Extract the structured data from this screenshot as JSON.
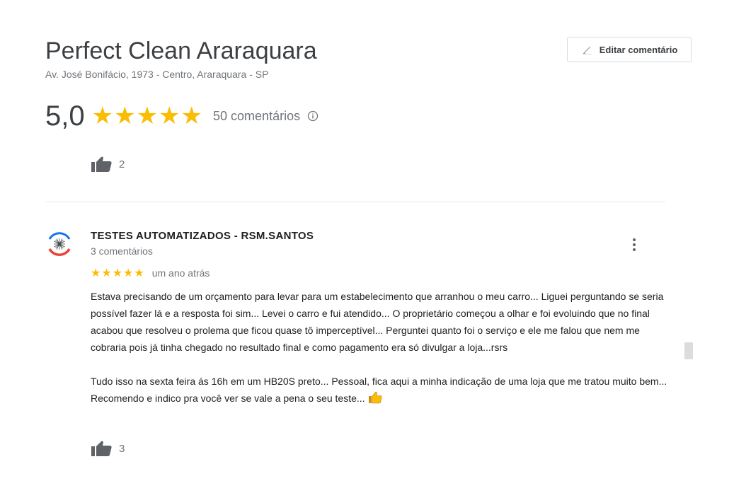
{
  "place": {
    "name": "Perfect Clean Araraquara",
    "address": "Av. José Bonifácio, 1973 - Centro, Araraquara - SP",
    "rating": "5,0",
    "stars": "★★★★★",
    "review_count": "50 comentários",
    "likes": "2"
  },
  "header": {
    "edit_label": "Editar comentário"
  },
  "review": {
    "author": "TESTES AUTOMATIZADOS - RSM.SANTOS",
    "author_reviews": "3 comentários",
    "stars": "★★★★★",
    "rating": 5,
    "date": "um ano atrás",
    "paragraph1": "Estava precisando de um orçamento para levar para um estabelecimento que arranhou o meu carro... Liguei perguntando se seria possível fazer lá e a resposta foi sim... Levei o carro e fui atendido... O proprietário começou a olhar e foi evoluindo que no final acabou que resolveu o prolema que ficou quase tô imperceptível... Perguntei quanto foi o serviço e ele me falou que nem me cobraria pois já tinha chegado no resultado final e como pagamento era só divulgar a loja...rsrs",
    "paragraph2": "Tudo isso na sexta feira ás 16h em um HB20S preto... Pessoal, fica aqui a minha indicação de uma loja que me tratou muito bem... Recomendo e indico pra você ver se vale a pena o seu teste...",
    "likes": "3"
  },
  "avatar": {
    "top_text": "RSM.SANTOS",
    "bottom_text": "TESTES AUTOMATIZADOS"
  },
  "colors": {
    "star": "#fbbc04",
    "text_secondary": "#70757a",
    "divider": "#e8eaed"
  },
  "icons": {
    "edit": "pencil-icon",
    "info": "info-icon",
    "like": "thumbs-up-icon",
    "more": "more-vert-icon",
    "emoji": "thumbs-up-emoji"
  }
}
